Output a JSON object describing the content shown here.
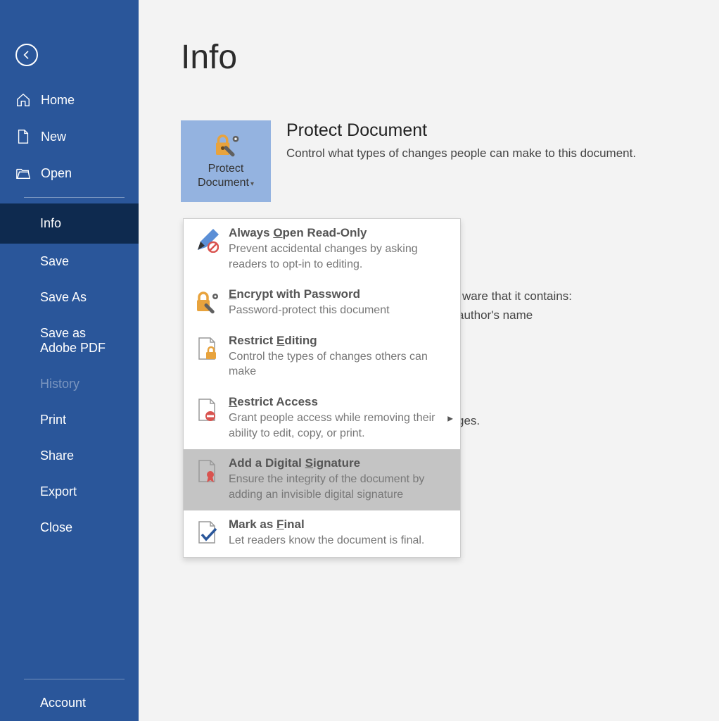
{
  "page": {
    "title": "Info"
  },
  "sidebar": {
    "home": "Home",
    "new": "New",
    "open": "Open",
    "info": "Info",
    "save": "Save",
    "save_as": "Save As",
    "save_adobe": "Save as Adobe PDF",
    "history": "History",
    "print": "Print",
    "share": "Share",
    "export": "Export",
    "close": "Close",
    "account": "Account"
  },
  "protect": {
    "title": "Protect Document",
    "desc": "Control what types of changes people can make to this document.",
    "btn_line1": "Protect",
    "btn_line2": "Document"
  },
  "ghost": {
    "line1": "ware that it contains:",
    "line2": "author's name",
    "line3": "ges."
  },
  "menu": {
    "readonly": {
      "title_pre": "Always ",
      "title_u": "O",
      "title_post": "pen Read-Only",
      "desc": "Prevent accidental changes by asking readers to opt-in to editing."
    },
    "encrypt": {
      "title_u": "E",
      "title_post": "ncrypt with Password",
      "desc": "Password-protect this document"
    },
    "restrict_editing": {
      "title_pre": "Restrict ",
      "title_u": "E",
      "title_post": "diting",
      "desc": "Control the types of changes others can make"
    },
    "restrict_access": {
      "title_u": "R",
      "title_post": "estrict Access",
      "desc": "Grant people access while removing their ability to edit, copy, or print."
    },
    "signature": {
      "title_pre": "Add a Digital ",
      "title_u": "S",
      "title_post": "ignature",
      "desc": "Ensure the integrity of the document by adding an invisible digital signature"
    },
    "final": {
      "title_pre": "Mark as ",
      "title_u": "F",
      "title_post": "inal",
      "desc": "Let readers know the document is final."
    }
  }
}
